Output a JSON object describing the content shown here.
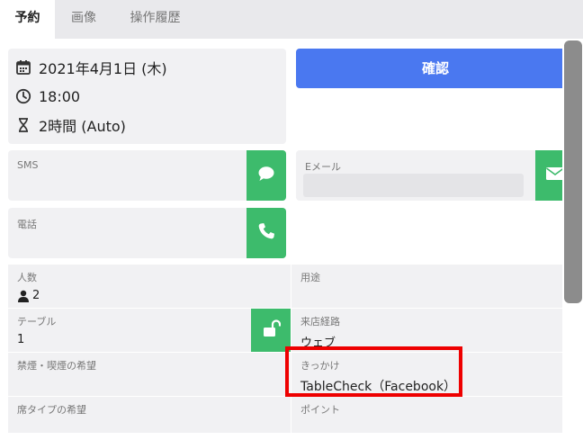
{
  "tabs": [
    {
      "label": "予約"
    },
    {
      "label": "画像"
    },
    {
      "label": "操作履歴"
    }
  ],
  "summary": {
    "date": "2021年4月1日 (木)",
    "time": "18:00",
    "duration": "2時間 (Auto)"
  },
  "confirm_label": "確認",
  "contacts": {
    "sms_label": "SMS",
    "email_label": "Eメール",
    "phone_label": "電話"
  },
  "details": {
    "party_size_label": "人数",
    "party_size_value": "2",
    "purpose_label": "用途",
    "table_label": "テーブル",
    "table_value": "1",
    "channel_label": "来店経路",
    "channel_value": "ウェブ",
    "smoking_label": "禁煙・喫煙の希望",
    "trigger_label": "きっかけ",
    "trigger_value": "TableCheck（Facebook）",
    "seat_type_label": "席タイプの希望",
    "points_label": "ポイント"
  },
  "colors": {
    "accent_blue": "#4a78f0",
    "action_green": "#3dbb6c",
    "highlight_red": "#ee0000"
  },
  "icons": {
    "date": "calendar-icon",
    "time": "clock-icon",
    "duration": "hourglass-icon",
    "sms": "chat-bubble-icon",
    "email": "envelope-icon",
    "phone": "phone-icon",
    "party_size": "person-icon",
    "table_lock": "unlock-icon"
  }
}
